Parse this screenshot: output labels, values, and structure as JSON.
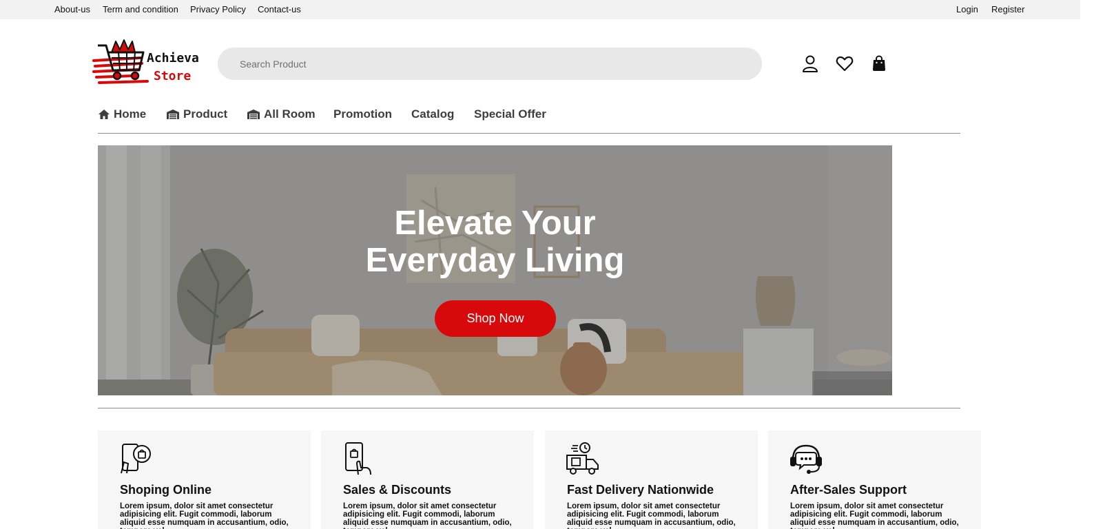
{
  "topbar": {
    "links": [
      "About-us",
      "Term and condition",
      "Privacy Policy",
      "Contact-us"
    ],
    "login": "Login",
    "register": "Register"
  },
  "logo": {
    "line1": "Achieva",
    "line2": "Store",
    "accent": "#d8090b"
  },
  "search": {
    "placeholder": "Search Product",
    "value": ""
  },
  "header_icons": [
    "user-icon",
    "heart-icon",
    "shopping-bag-icon"
  ],
  "nav": [
    {
      "label": "Home",
      "icon": "home-icon"
    },
    {
      "label": "Product",
      "icon": "warehouse-icon"
    },
    {
      "label": "All Room",
      "icon": "warehouse-icon"
    },
    {
      "label": "Promotion"
    },
    {
      "label": "Catalog"
    },
    {
      "label": "Special Offer"
    }
  ],
  "hero": {
    "title_line1": "Elevate Your",
    "title_line2": "Everyday Living",
    "button": "Shop Now",
    "button_color": "#d8090b"
  },
  "features": [
    {
      "title": "Shoping Online",
      "icon": "phone-shopping-icon",
      "desc": "Lorem ipsum, dolor sit amet consectetur adipisicing elit. Fugit commodi, laborum aliquid esse numquam in accusantium, odio, tempore vel."
    },
    {
      "title": "Sales & Discounts",
      "icon": "phone-tap-icon",
      "desc": "Lorem ipsum, dolor sit amet consectetur adipisicing elit. Fugit commodi, laborum aliquid esse numquam in accusantium, odio, tempore vel."
    },
    {
      "title": "Fast Delivery Nationwide",
      "icon": "delivery-truck-icon",
      "desc": "Lorem ipsum, dolor sit amet consectetur adipisicing elit. Fugit commodi, laborum aliquid esse numquam in accusantium, odio, tempore vel."
    },
    {
      "title": "After-Sales Support",
      "icon": "support-headset-icon",
      "desc": "Lorem ipsum, dolor sit amet consectetur adipisicing elit. Fugit commodi, laborum aliquid esse numquam in accusantium, odio, tempore vel."
    }
  ]
}
